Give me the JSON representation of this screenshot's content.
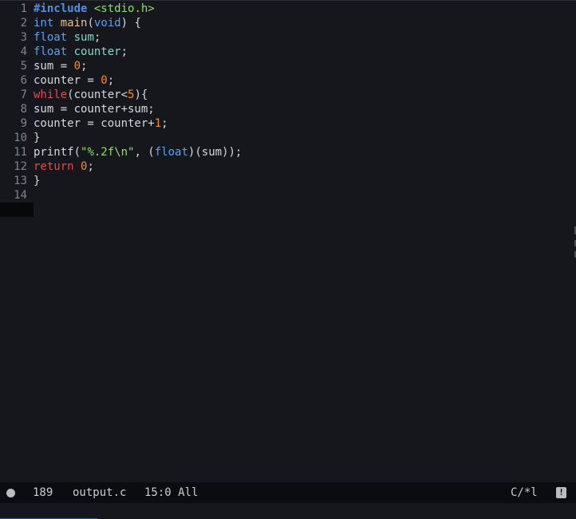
{
  "editor": {
    "lines": [
      {
        "n": "1",
        "tokens": [
          {
            "t": "#include",
            "c": "kw-pre"
          },
          {
            "t": " ",
            "c": "plain"
          },
          {
            "t": "<stdio.h>",
            "c": "str"
          }
        ]
      },
      {
        "n": "2",
        "tokens": [
          {
            "t": "int",
            "c": "kw-type"
          },
          {
            "t": " ",
            "c": "plain"
          },
          {
            "t": "main",
            "c": "fn"
          },
          {
            "t": "(",
            "c": "plain"
          },
          {
            "t": "void",
            "c": "kw-type"
          },
          {
            "t": ") {",
            "c": "plain"
          }
        ]
      },
      {
        "n": "3",
        "tokens": [
          {
            "t": "float",
            "c": "kw-type"
          },
          {
            "t": " ",
            "c": "plain"
          },
          {
            "t": "sum",
            "c": "var"
          },
          {
            "t": ";",
            "c": "plain"
          }
        ]
      },
      {
        "n": "4",
        "tokens": [
          {
            "t": "float",
            "c": "kw-type"
          },
          {
            "t": " ",
            "c": "plain"
          },
          {
            "t": "counter",
            "c": "var"
          },
          {
            "t": ";",
            "c": "plain"
          }
        ]
      },
      {
        "n": "5",
        "tokens": [
          {
            "t": "sum = ",
            "c": "plain"
          },
          {
            "t": "0",
            "c": "num"
          },
          {
            "t": ";",
            "c": "plain"
          }
        ]
      },
      {
        "n": "6",
        "tokens": [
          {
            "t": "counter = ",
            "c": "plain"
          },
          {
            "t": "0",
            "c": "num"
          },
          {
            "t": ";",
            "c": "plain"
          }
        ]
      },
      {
        "n": "7",
        "tokens": [
          {
            "t": "while",
            "c": "kw-ctrl"
          },
          {
            "t": "(counter<",
            "c": "plain"
          },
          {
            "t": "5",
            "c": "num"
          },
          {
            "t": "){",
            "c": "plain"
          }
        ]
      },
      {
        "n": "8",
        "tokens": [
          {
            "t": "sum = counter+sum;",
            "c": "plain"
          }
        ]
      },
      {
        "n": "9",
        "tokens": [
          {
            "t": "counter = counter+",
            "c": "plain"
          },
          {
            "t": "1",
            "c": "num"
          },
          {
            "t": ";",
            "c": "plain"
          }
        ]
      },
      {
        "n": "10",
        "tokens": [
          {
            "t": "}",
            "c": "plain"
          }
        ]
      },
      {
        "n": "11",
        "tokens": [
          {
            "t": "printf(",
            "c": "plain"
          },
          {
            "t": "\"%.2f\\n\"",
            "c": "str"
          },
          {
            "t": ", (",
            "c": "plain"
          },
          {
            "t": "float",
            "c": "kw-type"
          },
          {
            "t": ")(sum));",
            "c": "plain"
          }
        ]
      },
      {
        "n": "12",
        "tokens": [
          {
            "t": "return",
            "c": "kw-ctrl"
          },
          {
            "t": " ",
            "c": "plain"
          },
          {
            "t": "0",
            "c": "num"
          },
          {
            "t": ";",
            "c": "plain"
          }
        ]
      },
      {
        "n": "13",
        "tokens": [
          {
            "t": "}",
            "c": "plain"
          }
        ]
      },
      {
        "n": "14",
        "tokens": []
      }
    ]
  },
  "modeline": {
    "size": "189",
    "buffer_name": "output.c",
    "position": "15:0 All",
    "mode": "C/*l",
    "badge_icon": "exclamation-icon",
    "badge_glyph": "!"
  },
  "colors": {
    "background": "#15171d",
    "modeline_bg": "#0b0c0f",
    "keyword": "#5aa2f0",
    "control": "#e44b4b",
    "string": "#8ee06a",
    "number": "#ff8a2a",
    "function": "#ecc48d",
    "variable": "#7fdbca"
  }
}
